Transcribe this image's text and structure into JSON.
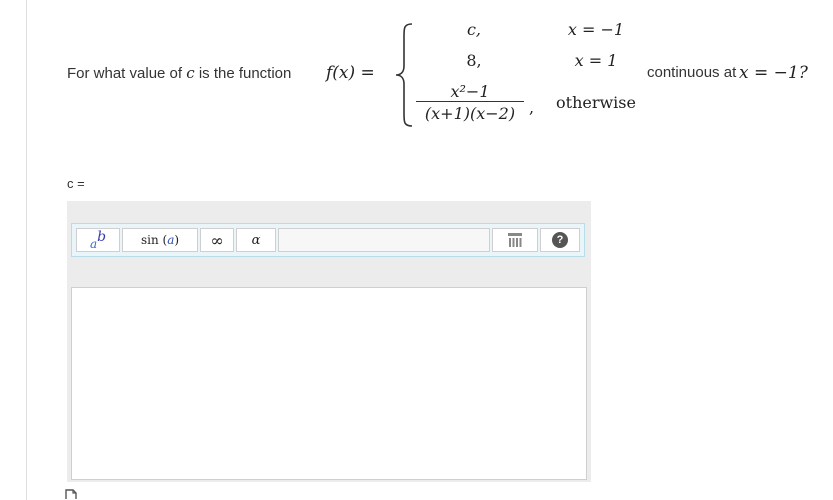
{
  "question": {
    "prefix": "For what value of",
    "variable_c": "c",
    "middle": "is the function",
    "func_lhs": "f(x) =",
    "cases": [
      {
        "value": "c,",
        "condition": "x = −1"
      },
      {
        "value": "8,",
        "condition": "x = 1"
      },
      {
        "numerator": "x²−1",
        "denominator": "(x+1)(x−2)",
        "comma": ",",
        "condition": "otherwise"
      }
    ],
    "suffix": "continuous at",
    "suffix_math": "x = −1?"
  },
  "answer": {
    "label": "c ="
  },
  "toolbar": {
    "power_base": "a",
    "power_exp": "b",
    "sin_func": "sin",
    "sin_arg": "a",
    "infinity": "∞",
    "alpha": "α",
    "help": "?"
  },
  "colors": {
    "toolbar_bg": "#eaf5f9",
    "toolbar_border": "#b8dde9",
    "editor_bg": "#ececec"
  },
  "icons": [
    "power-icon",
    "sine-icon",
    "infinity-icon",
    "alpha-icon",
    "matrix-icon",
    "help-icon",
    "document-icon"
  ]
}
